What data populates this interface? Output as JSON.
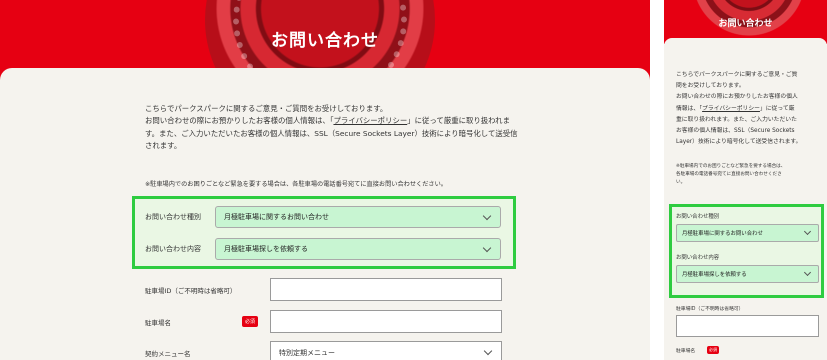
{
  "page": {
    "title": "お問い合わせ",
    "intro_before_link": "こちらでパークスパークに関するご意見・ご質問をお受けしております。お問い合わせの際にお預かりしたお客様の個人情報は、「",
    "privacy_link": "プライバシーポリシー",
    "intro_after_link": "」に従って厳重に取り扱われます。また、ご入力いただいたお客様の個人情報は、SSL（Secure Sockets Layer）技術により暗号化して送受信されます。",
    "note": "※駐車場内でのお困りごとなど緊急を要する場合は、各駐車場の電話番号宛てに直接お問い合わせください。",
    "desktop_intro_line1": "こちらでパークスパークに関するご意見・ご質問をお受けしております。",
    "desktop_intro_line2a": "お問い合わせの際にお預かりしたお客様の個人情報は、「",
    "desktop_intro_line2b": "」に従って厳重に取り扱われま",
    "desktop_intro_line3": "す。また、ご入力いただいたお客様の個人情報は、SSL（Secure Sockets Layer）技術により暗号化して送受信",
    "desktop_intro_line4": "されます。"
  },
  "form": {
    "inquiry_type_label": "お問い合わせ種別",
    "inquiry_type_value": "月極駐車場に関するお問い合わせ",
    "inquiry_content_label": "お問い合わせ内容",
    "inquiry_content_value": "月極駐車場探しを依頼する",
    "parking_id_label": "駐車場ID（ご不明時は省略可）",
    "parking_name_label": "駐車場名",
    "required_badge": "必須",
    "contract_menu_label": "契約メニュー名",
    "contract_menu_value": "特別定期メニュー"
  },
  "mobile": {
    "intro_lines": [
      "こちらでパークスパークに関するご意見・ご質",
      "問をお受けしております。",
      "お問い合わせの際にお預かりしたお客様の個人",
      "情報は、「",
      "」に従って厳",
      "重に取り扱われます。また、ご入力いただいた",
      "お客様の個人情報は、SSL（Secure Sockets",
      "Layer）技術により暗号化して送受信されます。"
    ],
    "note_lines": [
      "※駐車場内でのお困りごとなど緊急を要する場合は、",
      "各駐車場の電話番号宛てに直接お問い合わせくださ",
      "い。"
    ]
  },
  "colors": {
    "brand_red": "#e60012",
    "highlight_green": "#2ecc40",
    "select_fill": "#c8f5d2",
    "card_bg": "#f5f3ee"
  },
  "icons": {
    "select_arrow": "chevron-down-icon"
  }
}
